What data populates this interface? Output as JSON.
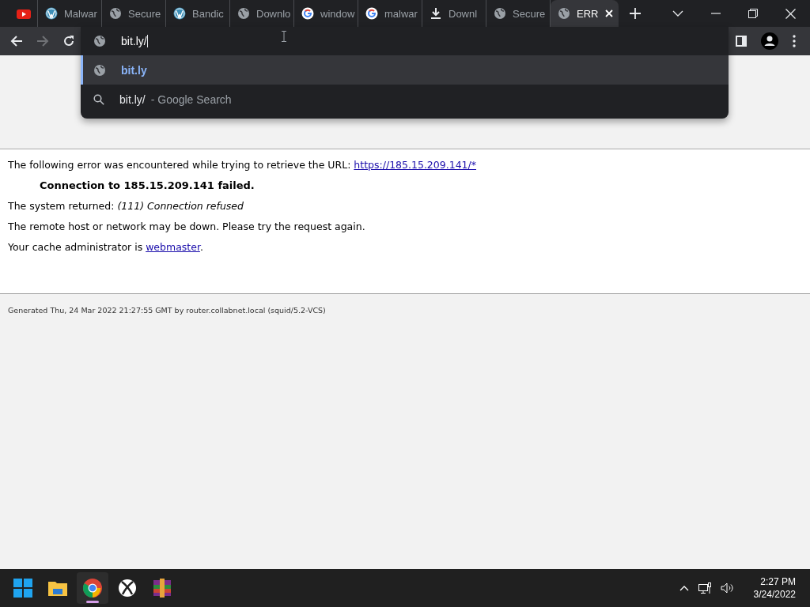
{
  "tabs": [
    {
      "kind": "youtube",
      "selected": false
    },
    {
      "kind": "wordpress",
      "title": "Malwar",
      "selected": false
    },
    {
      "kind": "globe",
      "title": "Secure",
      "selected": false
    },
    {
      "kind": "wordpress",
      "title": "Bandic",
      "selected": false
    },
    {
      "kind": "globe",
      "title": "Downlo",
      "selected": false
    },
    {
      "kind": "google",
      "title": "window",
      "selected": false
    },
    {
      "kind": "google",
      "title": "malwar",
      "selected": false
    },
    {
      "kind": "download",
      "title": "Downl",
      "selected": false
    },
    {
      "kind": "globe",
      "title": "Secure",
      "selected": false
    },
    {
      "kind": "globe",
      "title": "ERR",
      "selected": true
    }
  ],
  "address_bar": {
    "value": "bit.ly/"
  },
  "suggestions": [
    {
      "kind": "url",
      "text": "bit.ly",
      "selected": true
    },
    {
      "kind": "search",
      "text": "bit.ly/",
      "hint": "- Google Search",
      "selected": false
    }
  ],
  "page": {
    "error_intro": "The following error was encountered while trying to retrieve the URL:",
    "error_link": "https://185.15.209.141/*",
    "failure": "Connection to 185.15.209.141 failed.",
    "system_returned": "The system returned: *(111) Connection refused*",
    "advice": "The remote host or network may be down. Please try the request again.",
    "admin_text": "Your cache administrator is",
    "admin_link": "webmaster",
    "admin_end": ".",
    "footer": "Generated Thu, 24 Mar 2022 21:27:55 GMT by router.collabnet.local (squid/5.2-VCS)"
  },
  "taskbar": {
    "apps": [
      {
        "kind": "windows",
        "active": false
      },
      {
        "kind": "folder",
        "active": false
      },
      {
        "kind": "chrome",
        "active": true
      },
      {
        "kind": "xbox",
        "active": false
      },
      {
        "kind": "archive",
        "active": false
      }
    ],
    "time": "2:27 PM",
    "date": "3/24/2022"
  }
}
